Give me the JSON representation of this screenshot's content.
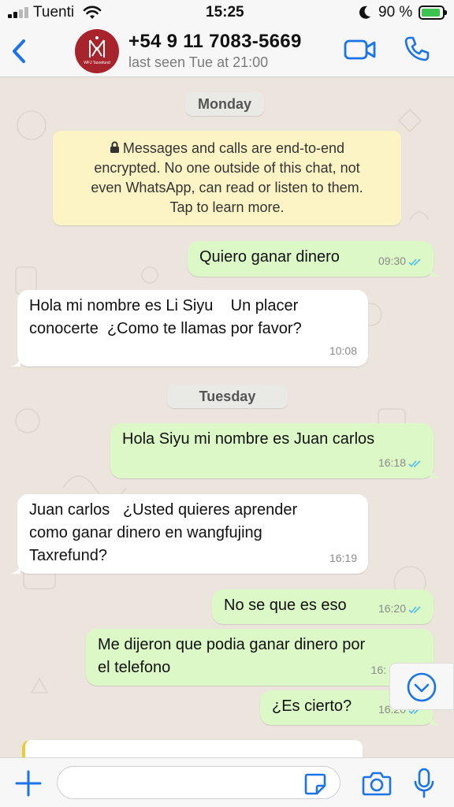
{
  "status_bar": {
    "carrier": "Tuenti",
    "time": "15:25",
    "battery_percent": "90 %",
    "battery_level": 0.9
  },
  "header": {
    "contact_name": "+54 9 11 7083-5669",
    "last_seen": "last seen Tue at 21:00",
    "avatar_text": "WFJ Taxrefund"
  },
  "chat": {
    "day_labels": [
      "Monday",
      "Tuesday"
    ],
    "encryption_notice": {
      "lines": [
        "Messages and calls are end-to-end",
        "encrypted. No one outside of this chat, not",
        "even WhatsApp, can read or listen to them.",
        "Tap to learn more."
      ]
    },
    "messages": [
      {
        "direction": "out",
        "text": "Quiero ganar dinero",
        "time": "09:30",
        "read": true
      },
      {
        "direction": "in",
        "text": "Hola mi nombre es Li Siyu    Un placer\nconocerte  ¿Como te llamas por favor?",
        "time": "10:08"
      },
      {
        "direction": "out",
        "text": "Hola Siyu mi nombre es Juan carlos",
        "time": "16:18",
        "read": true
      },
      {
        "direction": "in",
        "text": "Juan carlos   ¿Usted quieres aprender\ncomo ganar dinero en wangfujing\nTaxrefund?",
        "time": "16:19"
      },
      {
        "direction": "out",
        "text": "No se que es eso",
        "time": "16:20",
        "read": true
      },
      {
        "direction": "out",
        "text": "Me dijeron que podia ganar dinero por\nel telefono",
        "time": "16:",
        "read": false
      },
      {
        "direction": "out",
        "text": "¿Es cierto?",
        "time": "16:20",
        "read": true
      }
    ]
  },
  "colors": {
    "accent_blue": "#1a73e8",
    "outgoing_bubble": "#dcf8c6",
    "incoming_bubble": "#ffffff",
    "notice_bg": "#fdf4c5",
    "read_ticks": "#53bdeb",
    "avatar_bg": "#a8242c"
  },
  "icons": {
    "back": "chevron-left-icon",
    "video": "video-camera-icon",
    "call": "phone-icon",
    "lock": "lock-icon",
    "scroll_down": "chevron-down-circle-icon",
    "plus": "plus-icon",
    "sticker": "sticker-icon",
    "camera": "camera-icon",
    "mic": "microphone-icon"
  }
}
